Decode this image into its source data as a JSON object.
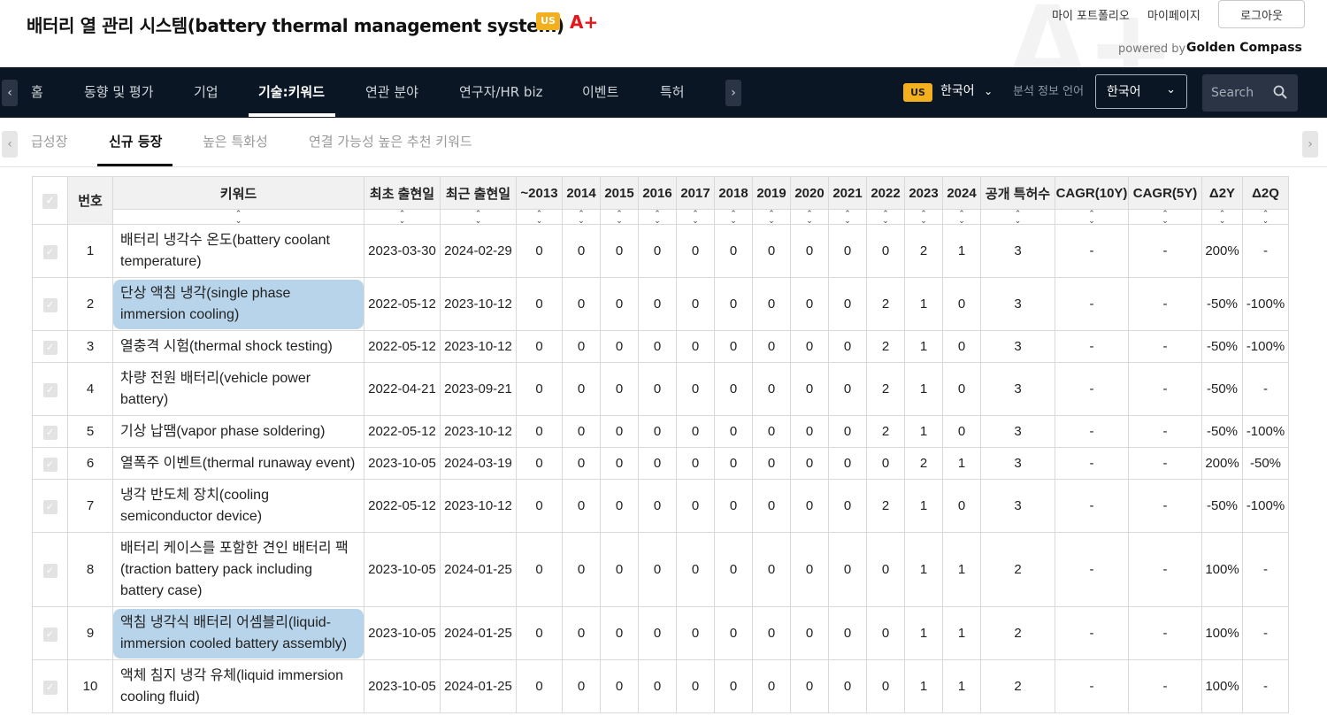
{
  "header": {
    "title": "배터리 열 관리 시스템(battery thermal management system)",
    "country_badge": "US",
    "grade": "A+",
    "watermark": "A+",
    "links": [
      "마이 포트폴리오",
      "마이페이지"
    ],
    "logout_label": "로그아웃",
    "powered_by": "powered by",
    "brand": "Golden Compass"
  },
  "nav": {
    "items": [
      "홈",
      "동향 및 평가",
      "기업",
      "기술:키워드",
      "연관 분야",
      "연구자/HR biz",
      "이벤트",
      "특허"
    ],
    "active_index": 3,
    "country_badge": "US",
    "language_current": "한국어",
    "language_caption": "분석 정보 언어",
    "language_select_value": "한국어",
    "search_placeholder": "Search"
  },
  "subtabs": {
    "items": [
      "급성장",
      "신규 등장",
      "높은 특화성",
      "연결 가능성 높은 추천 키워드"
    ],
    "active_index": 1
  },
  "table": {
    "columns": [
      "번호",
      "키워드",
      "최초 출현일",
      "최근 출현일",
      "~2013",
      "2014",
      "2015",
      "2016",
      "2017",
      "2018",
      "2019",
      "2020",
      "2021",
      "2022",
      "2023",
      "2024",
      "공개 특허수",
      "CAGR(10Y)",
      "CAGR(5Y)",
      "Δ2Y",
      "Δ2Q"
    ],
    "sort_glyph": "⌃\n⌄",
    "rows": [
      {
        "no": "1",
        "kw": "배터리 냉각수 온도(battery coolant temperature)",
        "first": "2023-03-30",
        "last": "2024-02-29",
        "years": [
          "0",
          "0",
          "0",
          "0",
          "0",
          "0",
          "0",
          "0",
          "0",
          "0",
          "2",
          "1"
        ],
        "patents": "3",
        "cagr10": "-",
        "cagr5": "-",
        "d2y": "200%",
        "d2q": "-",
        "highlight": false
      },
      {
        "no": "2",
        "kw": "단상 액침 냉각(single phase immersion cooling)",
        "first": "2022-05-12",
        "last": "2023-10-12",
        "years": [
          "0",
          "0",
          "0",
          "0",
          "0",
          "0",
          "0",
          "0",
          "0",
          "2",
          "1",
          "0"
        ],
        "patents": "3",
        "cagr10": "-",
        "cagr5": "-",
        "d2y": "-50%",
        "d2q": "-100%",
        "highlight": true
      },
      {
        "no": "3",
        "kw": "열충격 시험(thermal shock testing)",
        "first": "2022-05-12",
        "last": "2023-10-12",
        "years": [
          "0",
          "0",
          "0",
          "0",
          "0",
          "0",
          "0",
          "0",
          "0",
          "2",
          "1",
          "0"
        ],
        "patents": "3",
        "cagr10": "-",
        "cagr5": "-",
        "d2y": "-50%",
        "d2q": "-100%",
        "highlight": false
      },
      {
        "no": "4",
        "kw": "차량 전원 배터리(vehicle power battery)",
        "first": "2022-04-21",
        "last": "2023-09-21",
        "years": [
          "0",
          "0",
          "0",
          "0",
          "0",
          "0",
          "0",
          "0",
          "0",
          "2",
          "1",
          "0"
        ],
        "patents": "3",
        "cagr10": "-",
        "cagr5": "-",
        "d2y": "-50%",
        "d2q": "-",
        "highlight": false
      },
      {
        "no": "5",
        "kw": "기상 납땜(vapor phase soldering)",
        "first": "2022-05-12",
        "last": "2023-10-12",
        "years": [
          "0",
          "0",
          "0",
          "0",
          "0",
          "0",
          "0",
          "0",
          "0",
          "2",
          "1",
          "0"
        ],
        "patents": "3",
        "cagr10": "-",
        "cagr5": "-",
        "d2y": "-50%",
        "d2q": "-100%",
        "highlight": false
      },
      {
        "no": "6",
        "kw": "열폭주 이벤트(thermal runaway event)",
        "first": "2023-10-05",
        "last": "2024-03-19",
        "years": [
          "0",
          "0",
          "0",
          "0",
          "0",
          "0",
          "0",
          "0",
          "0",
          "0",
          "2",
          "1"
        ],
        "patents": "3",
        "cagr10": "-",
        "cagr5": "-",
        "d2y": "200%",
        "d2q": "-50%",
        "highlight": false
      },
      {
        "no": "7",
        "kw": "냉각 반도체 장치(cooling semiconductor device)",
        "first": "2022-05-12",
        "last": "2023-10-12",
        "years": [
          "0",
          "0",
          "0",
          "0",
          "0",
          "0",
          "0",
          "0",
          "0",
          "2",
          "1",
          "0"
        ],
        "patents": "3",
        "cagr10": "-",
        "cagr5": "-",
        "d2y": "-50%",
        "d2q": "-100%",
        "highlight": false
      },
      {
        "no": "8",
        "kw": "배터리 케이스를 포함한 견인 배터리 팩(traction battery pack including battery case)",
        "first": "2023-10-05",
        "last": "2024-01-25",
        "years": [
          "0",
          "0",
          "0",
          "0",
          "0",
          "0",
          "0",
          "0",
          "0",
          "0",
          "1",
          "1"
        ],
        "patents": "2",
        "cagr10": "-",
        "cagr5": "-",
        "d2y": "100%",
        "d2q": "-",
        "highlight": false
      },
      {
        "no": "9",
        "kw": "액침 냉각식 배터리 어셈블리(liquid-immersion cooled battery assembly)",
        "first": "2023-10-05",
        "last": "2024-01-25",
        "years": [
          "0",
          "0",
          "0",
          "0",
          "0",
          "0",
          "0",
          "0",
          "0",
          "0",
          "1",
          "1"
        ],
        "patents": "2",
        "cagr10": "-",
        "cagr5": "-",
        "d2y": "100%",
        "d2q": "-",
        "highlight": true
      },
      {
        "no": "10",
        "kw": "액체 침지 냉각 유체(liquid immersion cooling fluid)",
        "first": "2023-10-05",
        "last": "2024-01-25",
        "years": [
          "0",
          "0",
          "0",
          "0",
          "0",
          "0",
          "0",
          "0",
          "0",
          "0",
          "1",
          "1"
        ],
        "patents": "2",
        "cagr10": "-",
        "cagr5": "-",
        "d2y": "100%",
        "d2q": "-",
        "highlight": false
      }
    ]
  }
}
